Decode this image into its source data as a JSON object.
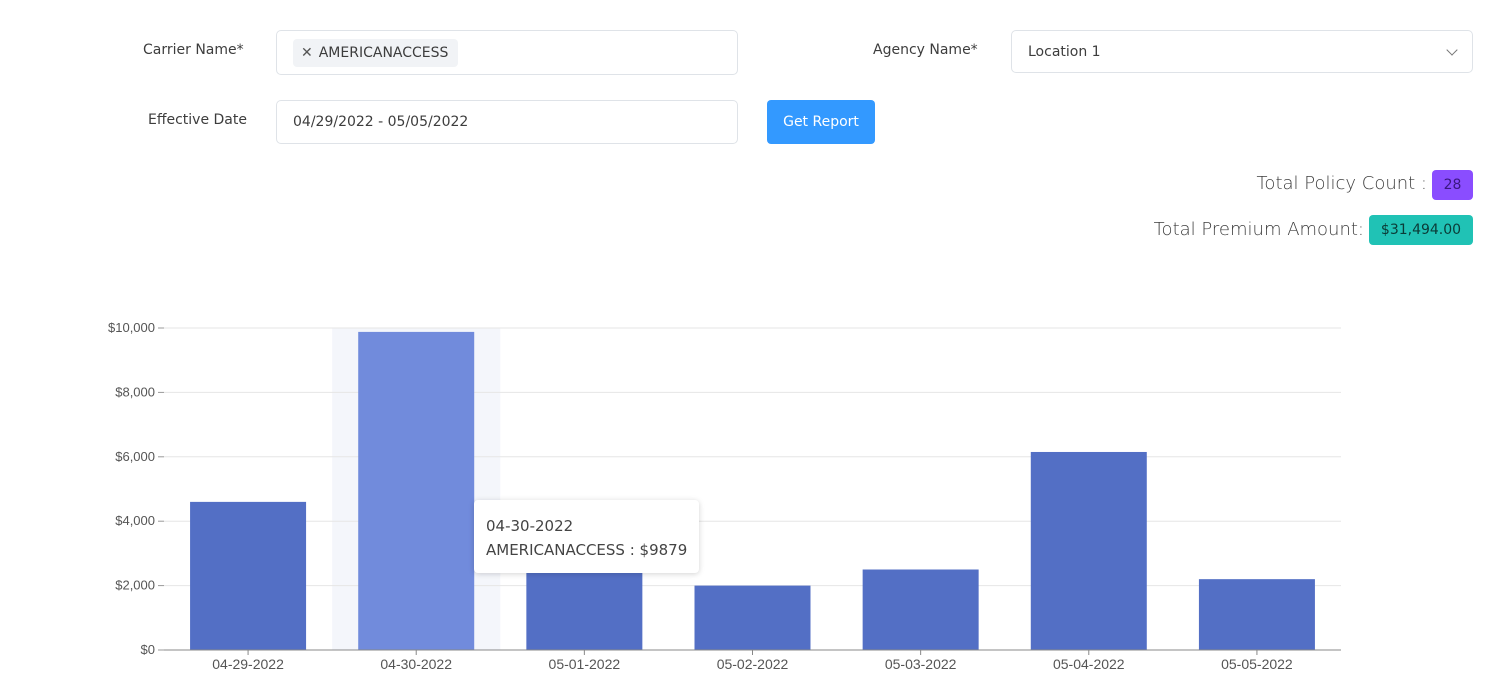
{
  "form": {
    "carrier_label": "Carrier Name*",
    "carrier_tag": "AMERICANACCESS",
    "agency_label": "Agency Name*",
    "agency_value": "Location 1",
    "date_label": "Effective Date",
    "date_value": "04/29/2022 - 05/05/2022",
    "get_report_label": "Get Report"
  },
  "summary": {
    "policy_count_label": "Total Policy Count :",
    "policy_count_value": "28",
    "premium_label": "Total Premium Amount:",
    "premium_value": "$31,494.00"
  },
  "tooltip": {
    "date": "04-30-2022",
    "text": "AMERICANACCESS : $9879"
  },
  "colors": {
    "bar": "#536fc5",
    "bar_highlight": "#718bdc",
    "hover_band": "#f4f6fb",
    "button": "#3399ff",
    "purple_badge": "#8a4dff",
    "teal_badge": "#20c2b5"
  },
  "chart_data": {
    "type": "bar",
    "categories": [
      "04-29-2022",
      "04-30-2022",
      "05-01-2022",
      "05-02-2022",
      "05-03-2022",
      "05-04-2022",
      "05-05-2022"
    ],
    "series": [
      {
        "name": "AMERICANACCESS",
        "values": [
          4600,
          9879,
          2400,
          2000,
          2500,
          6150,
          2200
        ]
      }
    ],
    "yticks": [
      "$0",
      "$2,000",
      "$4,000",
      "$6,000",
      "$8,000",
      "$10,000"
    ],
    "ylim": [
      0,
      10000
    ],
    "grid": true,
    "highlighted_category": "04-30-2022"
  }
}
